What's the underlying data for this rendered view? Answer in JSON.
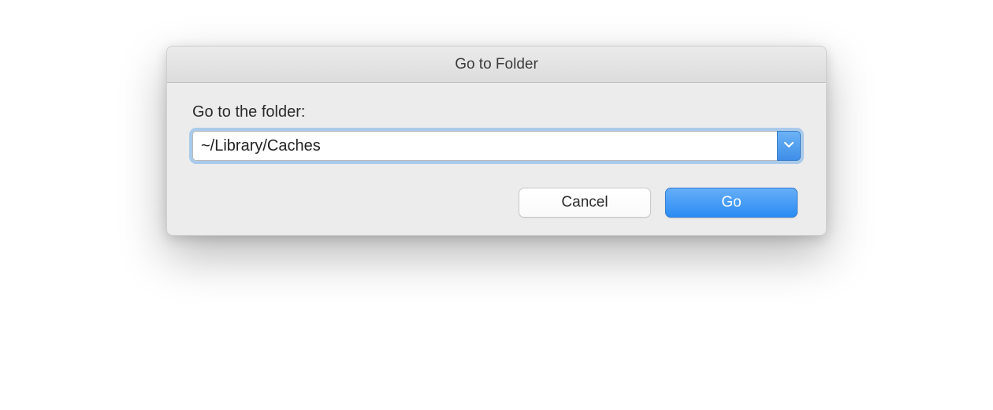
{
  "dialog": {
    "title": "Go to Folder",
    "label": "Go to the folder:",
    "path_value": "~/Library/Caches",
    "buttons": {
      "cancel": "Cancel",
      "go": "Go"
    }
  }
}
